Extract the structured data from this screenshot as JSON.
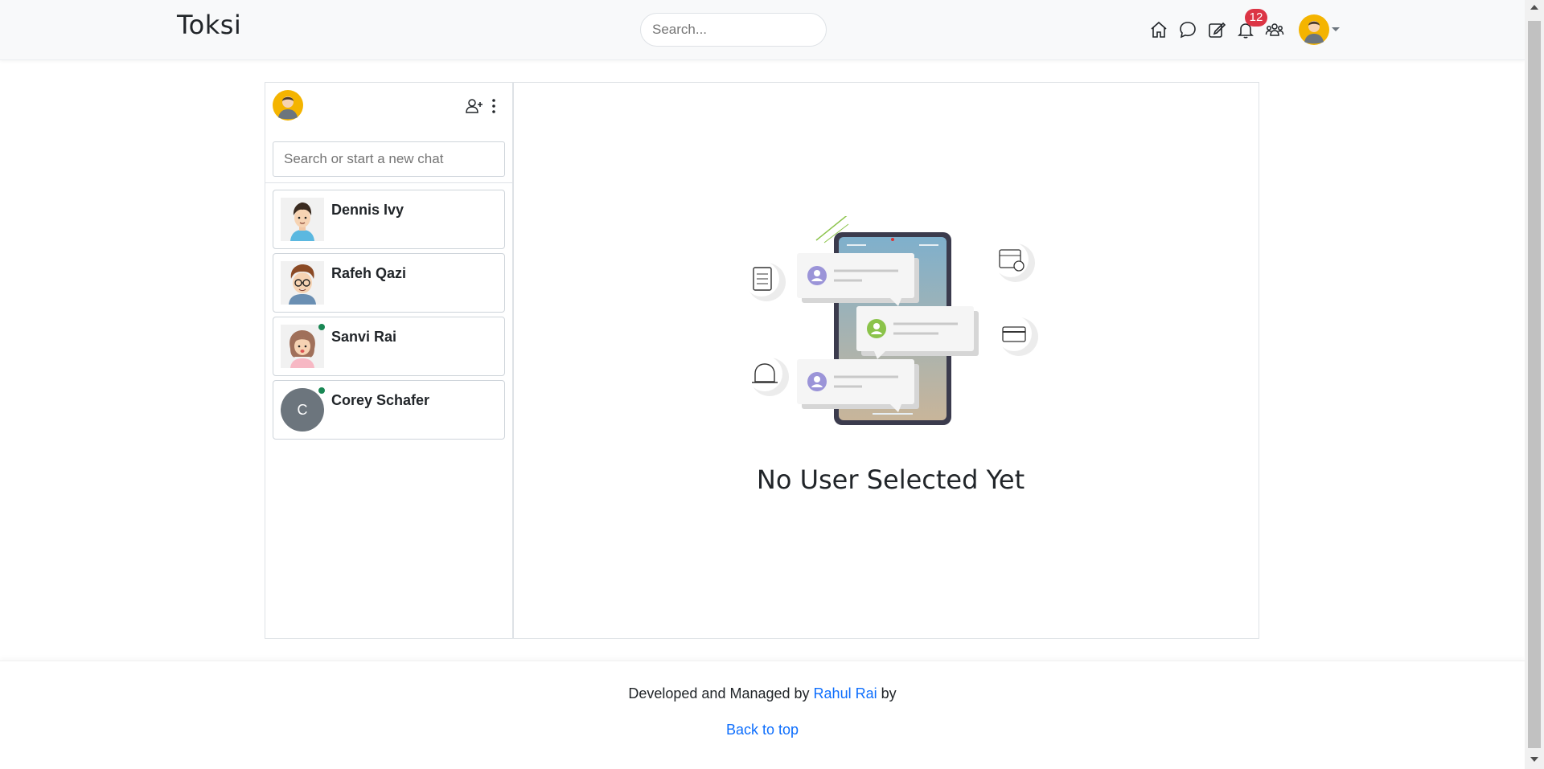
{
  "navbar": {
    "brand": "Toksi",
    "search_placeholder": "Search...",
    "icons": [
      "home-icon",
      "chat-icon",
      "edit-icon",
      "bell-icon",
      "people-icon"
    ],
    "notification_count": "12"
  },
  "sidebar": {
    "search_placeholder": "Search or start a new chat",
    "contacts": [
      {
        "name": "Dennis Ivy",
        "online": false,
        "avatar": "cartoon-man"
      },
      {
        "name": "Rafeh Qazi",
        "online": false,
        "avatar": "cartoon-glasses"
      },
      {
        "name": "Sanvi Rai",
        "online": true,
        "avatar": "cartoon-girl"
      },
      {
        "name": "Corey Schafer",
        "online": true,
        "avatar_letter": "C"
      }
    ]
  },
  "main": {
    "empty_message": "No User Selected Yet"
  },
  "footer": {
    "prefix": "Developed and Managed by",
    "author": "Rahul Rai",
    "suffix": "by",
    "back_to_top": "Back to top"
  },
  "colors": {
    "navbar_bg": "#f8f9fa",
    "link": "#0d6efd",
    "badge": "#dc3545",
    "online": "#198754"
  }
}
